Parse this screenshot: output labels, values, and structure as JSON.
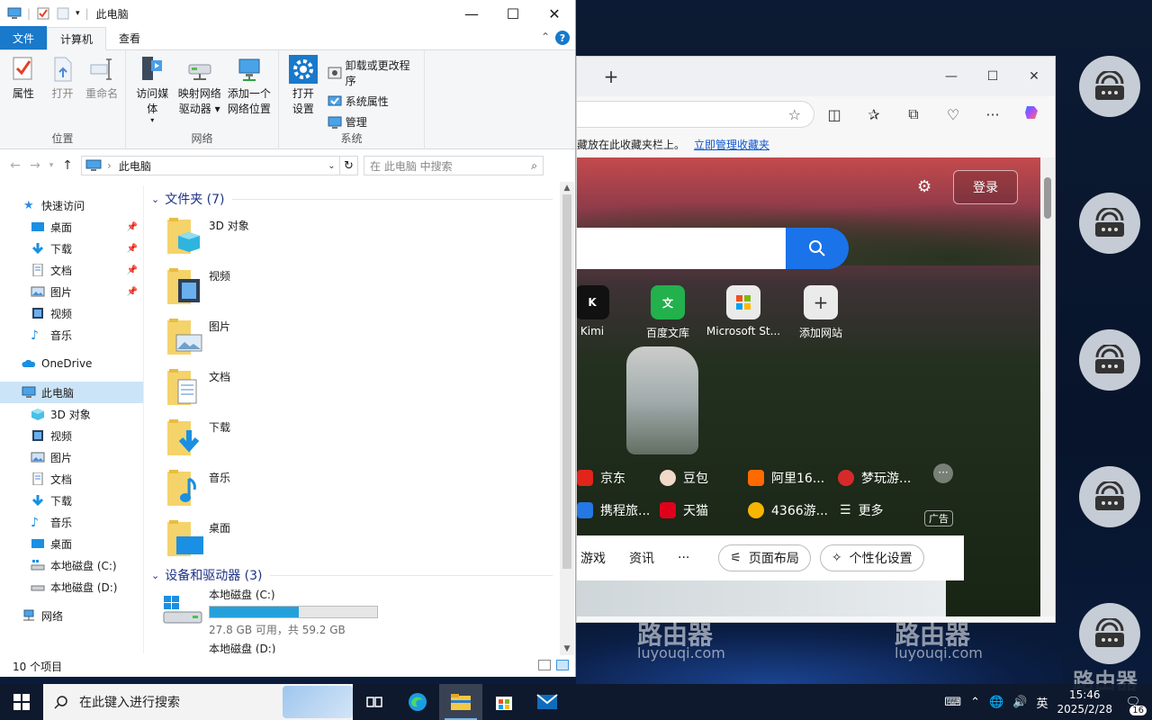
{
  "explorer": {
    "title": "此电脑",
    "tabs": [
      "文件",
      "计算机",
      "查看"
    ],
    "ribbon": {
      "location_group": "位置",
      "network_group": "网络",
      "system_group": "系统",
      "properties": "属性",
      "open": "打开",
      "rename": "重命名",
      "access_media": "访问媒体",
      "map_drive_1": "映射网络",
      "map_drive_2": "驱动器",
      "add_location_1": "添加一个",
      "add_location_2": "网络位置",
      "open_settings_1": "打开",
      "open_settings_2": "设置",
      "uninstall": "卸载或更改程序",
      "system_props": "系统属性",
      "manage": "管理"
    },
    "address": "此电脑",
    "search_placeholder": "在 此电脑 中搜索",
    "nav": {
      "quick_access": "快速访问",
      "qa_items": [
        "桌面",
        "下载",
        "文档",
        "图片",
        "视频",
        "音乐"
      ],
      "onedrive": "OneDrive",
      "this_pc": "此电脑",
      "pc_items": [
        "3D 对象",
        "视频",
        "图片",
        "文档",
        "下载",
        "音乐",
        "桌面",
        "本地磁盘 (C:)",
        "本地磁盘 (D:)"
      ],
      "network": "网络"
    },
    "folders_header": "文件夹 (7)",
    "folders": [
      "3D 对象",
      "视频",
      "图片",
      "文档",
      "下载",
      "音乐",
      "桌面"
    ],
    "drives_header": "设备和驱动器 (3)",
    "drive_c": {
      "name": "本地磁盘 (C:)",
      "free": "27.8 GB 可用，共 59.2 GB",
      "used_fraction": 0.53
    },
    "drive_d_name": "本地磁盘 (D:)",
    "status": "10 个项目"
  },
  "edge": {
    "fav_hint": "藏放在此收藏夹栏上。",
    "fav_link": "立即管理收藏夹",
    "login": "登录",
    "quick_links": [
      "Kimi",
      "百度文库",
      "Microsoft St...",
      "添加网站"
    ],
    "links_row1": [
      "京东",
      "豆包",
      "阿里16...",
      "梦玩游..."
    ],
    "links_row2": [
      "携程旅...",
      "天猫",
      "4366游...",
      "更多"
    ],
    "ad": "广告",
    "feed_tabs": [
      "游戏",
      "资讯",
      "···"
    ],
    "layout_btn": "页面布局",
    "personalize_btn": "个性化设置"
  },
  "watermark": {
    "text": "路由器",
    "url": "luyouqi.com"
  },
  "taskbar": {
    "search_placeholder": "在此键入进行搜索",
    "time": "15:46",
    "date": "2025/2/28",
    "ime": "英",
    "notif_count": "16"
  }
}
